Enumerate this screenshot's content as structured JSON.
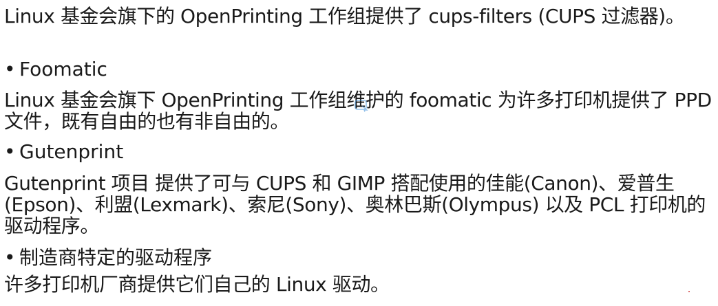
{
  "blocks": {
    "p1": "Linux 基金会旗下的 OpenPrinting 工作组提供了 cups-filters (CUPS 过滤器)。",
    "b1": "Foomatic",
    "p2": "Linux 基金会旗下 OpenPrinting 工作组维护的 foomatic 为许多打印机提供了 PPD 文件，既有自由的也有非自由的。",
    "b2": "Gutenprint",
    "p3": "Gutenprint 项目 提供了可与 CUPS 和 GIMP 搭配使用的佳能(Canon)、爱普生(Epson)、利盟(Lexmark)、索尼(Sony)、奥林巴斯(Olympus) 以及 PCL 打印机的驱动程序。",
    "b3": "制造商特定的驱动程序",
    "p4": "许多打印机厂商提供它们自己的 Linux 驱动。"
  },
  "bullet_symbol": "•",
  "colors": {
    "text": "#1a1a1a",
    "background": "#ffffff",
    "cursor": "#3b8fd9"
  }
}
